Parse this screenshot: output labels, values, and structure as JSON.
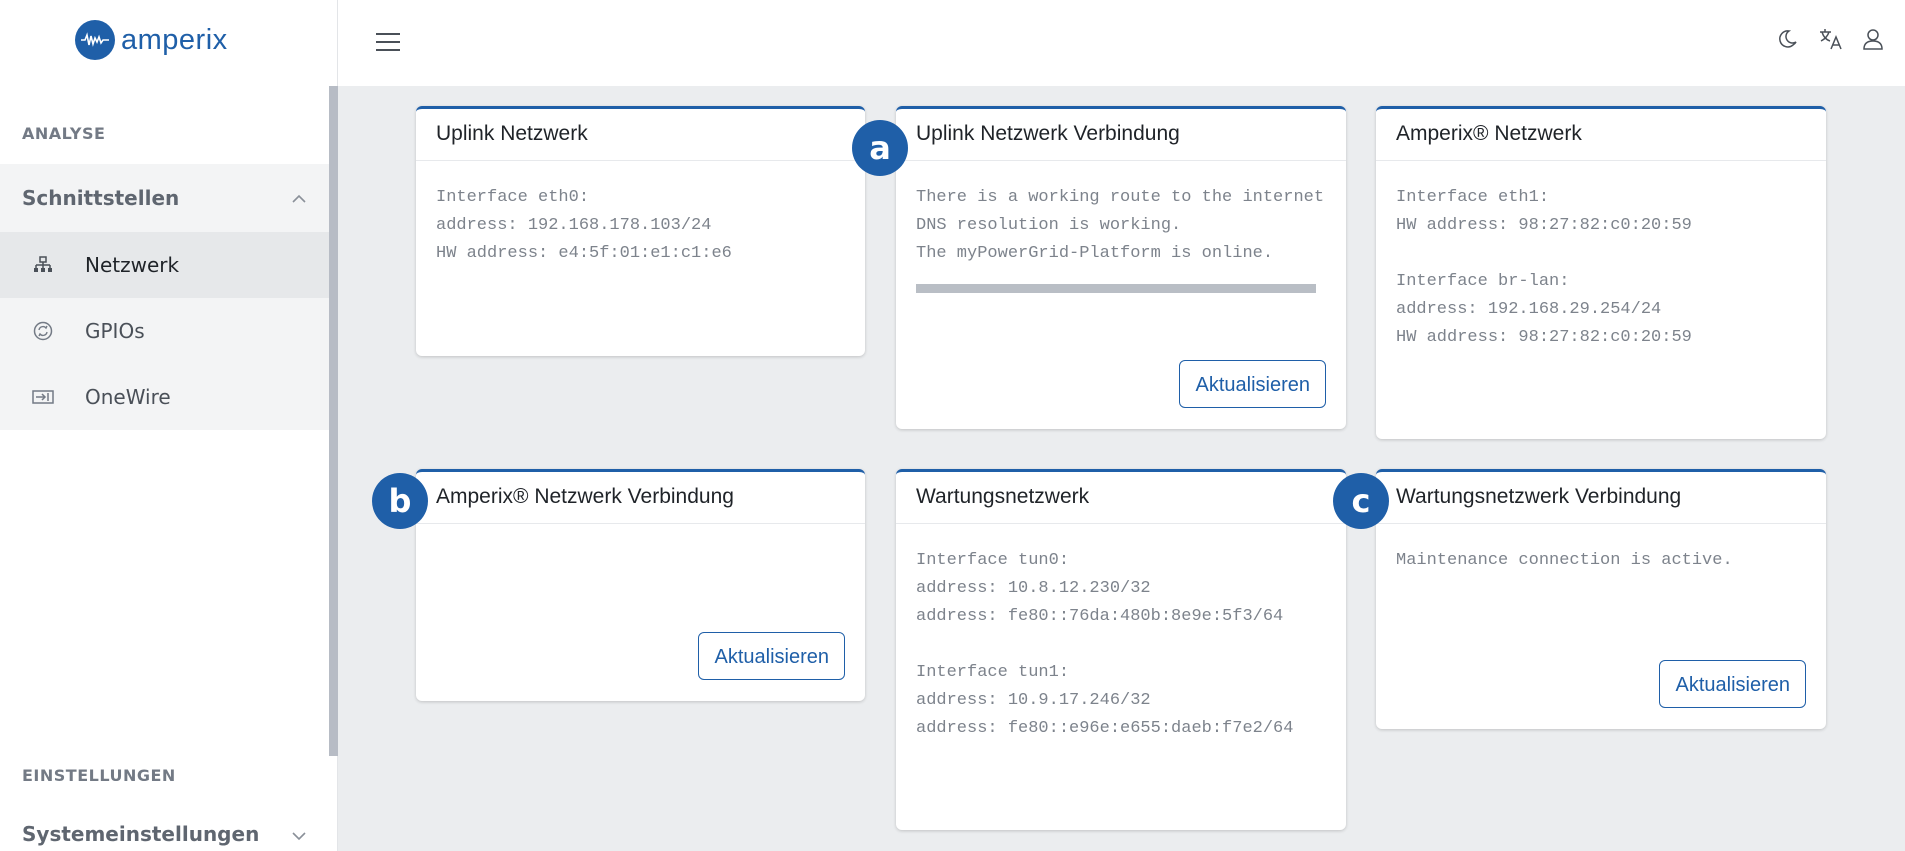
{
  "brand": {
    "name": "amperix"
  },
  "sidebar": {
    "section1": "ANALYSE",
    "group1": "Schnittstellen",
    "items": [
      {
        "label": "Netzwerk",
        "icon": "network-icon"
      },
      {
        "label": "GPIOs",
        "icon": "gpio-icon"
      },
      {
        "label": "OneWire",
        "icon": "onewire-icon"
      }
    ],
    "section2": "EINSTELLUNGEN",
    "group2": "Systemeinstellungen"
  },
  "topbar": {
    "icons": [
      "moon-icon",
      "translate-icon",
      "user-icon"
    ]
  },
  "cards": [
    {
      "title": "Uplink Netzwerk",
      "body": "Interface eth0:\naddress: 192.168.178.103/24\nHW address: e4:5f:01:e1:c1:e6"
    },
    {
      "title": "Uplink Netzwerk Verbindung",
      "body": "There is a working route to the internet\nDNS resolution is working.\nThe myPowerGrid-Platform is online.",
      "button": "Aktualisieren",
      "marker": "a",
      "progress": 1.0
    },
    {
      "title": "Amperix® Netzwerk",
      "body": "Interface eth1:\nHW address: 98:27:82:c0:20:59\n\nInterface br-lan:\naddress: 192.168.29.254/24\nHW address: 98:27:82:c0:20:59"
    },
    {
      "title": "Amperix® Netzwerk Verbindung",
      "body": "",
      "button": "Aktualisieren",
      "marker": "b"
    },
    {
      "title": "Wartungsnetzwerk",
      "body": "Interface tun0:\naddress: 10.8.12.230/32\naddress: fe80::76da:480b:8e9e:5f3/64\n\nInterface tun1:\naddress: 10.9.17.246/32\naddress: fe80::e96e:e655:daeb:f7e2/64"
    },
    {
      "title": "Wartungsnetzwerk Verbindung",
      "body": "Maintenance connection is active.",
      "button": "Aktualisieren",
      "marker": "c"
    }
  ],
  "colors": {
    "accent": "#1f5fa8",
    "background": "#ebedef"
  }
}
